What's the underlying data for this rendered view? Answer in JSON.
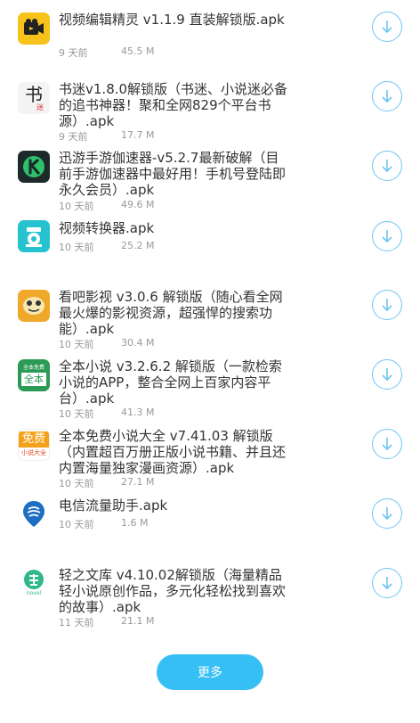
{
  "accent": "#35bff5",
  "items": [
    {
      "title": "视频编辑精灵 v1.1.9 直装解锁版.apk",
      "days": "9 天前",
      "size": "45.5 M",
      "icon": "video-editor-icon"
    },
    {
      "title": "书迷v1.8.0解锁版（书迷、小说迷必备的追书神器！聚和全网829个平台书源）.apk",
      "days": "9 天前",
      "size": "17.7 M",
      "icon": "shumi-icon"
    },
    {
      "title": "迅游手游伽速器-v5.2.7最新破解（目前手游伽速器中最好用！手机号登陆即永久会员）.apk",
      "days": "10 天前",
      "size": "49.6 M",
      "icon": "xunyou-icon"
    },
    {
      "title": "视频转换器.apk",
      "days": "10 天前",
      "size": "25.2 M",
      "icon": "video-converter-icon"
    },
    {
      "title": "看吧影视 v3.0.6 解锁版（随心看全网最火爆的影视资源，超强悍的搜索功能）.apk",
      "days": "10 天前",
      "size": "30.4 M",
      "icon": "kanba-icon"
    },
    {
      "title": "全本小说 v3.2.6.2 解锁版（一款检索小说的APP，整合全网上百家内容平台）.apk",
      "days": "10 天前",
      "size": "41.3 M",
      "icon": "quanben-icon"
    },
    {
      "title": "全本免费小说大全 v7.41.03 解锁版（内置超百万册正版小说书籍、并且还内置海量独家漫画资源）.apk",
      "days": "10 天前",
      "size": "27.1 M",
      "icon": "free-novel-icon"
    },
    {
      "title": "电信流量助手.apk",
      "days": "10 天前",
      "size": "1.6 M",
      "icon": "telecom-icon"
    },
    {
      "title": "轻之文库 v4.10.02解锁版（海量精品轻小说原创作品，多元化轻松找到喜欢的故事）.apk",
      "days": "11 天前",
      "size": "21.1 M",
      "icon": "novel-icon"
    }
  ],
  "icon_text": {
    "shumi": "书",
    "shumi_sub": "迷",
    "quanben_top": "全本免费",
    "quanben_main": "全本",
    "free_main": "免费",
    "free_sub": "小说大全",
    "novel_sub": "novel"
  },
  "more_label": "更多"
}
